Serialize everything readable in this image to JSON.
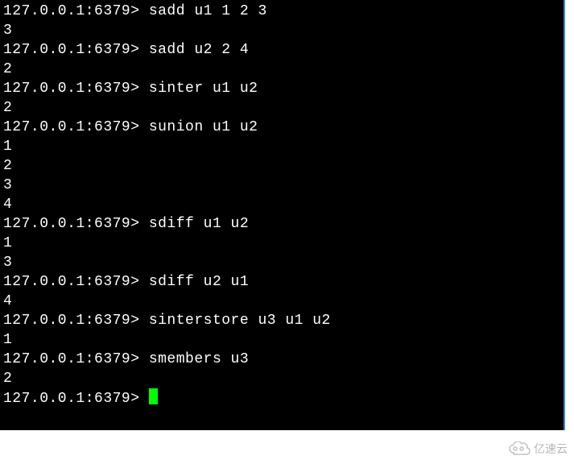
{
  "terminal": {
    "prompt": "127.0.0.1:6379>",
    "lines": [
      {
        "type": "cmd",
        "text": "127.0.0.1:6379> sadd u1 1 2 3"
      },
      {
        "type": "output",
        "text": "3"
      },
      {
        "type": "cmd",
        "text": "127.0.0.1:6379> sadd u2 2 4"
      },
      {
        "type": "output",
        "text": "2"
      },
      {
        "type": "cmd",
        "text": "127.0.0.1:6379> sinter u1 u2"
      },
      {
        "type": "output",
        "text": "2"
      },
      {
        "type": "cmd",
        "text": "127.0.0.1:6379> sunion u1 u2"
      },
      {
        "type": "output",
        "text": "1"
      },
      {
        "type": "output",
        "text": "2"
      },
      {
        "type": "output",
        "text": "3"
      },
      {
        "type": "output",
        "text": "4"
      },
      {
        "type": "cmd",
        "text": "127.0.0.1:6379> sdiff u1 u2"
      },
      {
        "type": "output",
        "text": "1"
      },
      {
        "type": "output",
        "text": "3"
      },
      {
        "type": "cmd",
        "text": "127.0.0.1:6379> sdiff u2 u1"
      },
      {
        "type": "output",
        "text": "4"
      },
      {
        "type": "cmd",
        "text": "127.0.0.1:6379> sinterstore u3 u1 u2"
      },
      {
        "type": "output",
        "text": "1"
      },
      {
        "type": "cmd",
        "text": "127.0.0.1:6379> smembers u3"
      },
      {
        "type": "output",
        "text": "2"
      },
      {
        "type": "prompt",
        "text": "127.0.0.1:6379> "
      }
    ]
  },
  "watermark": {
    "text": "亿速云"
  }
}
